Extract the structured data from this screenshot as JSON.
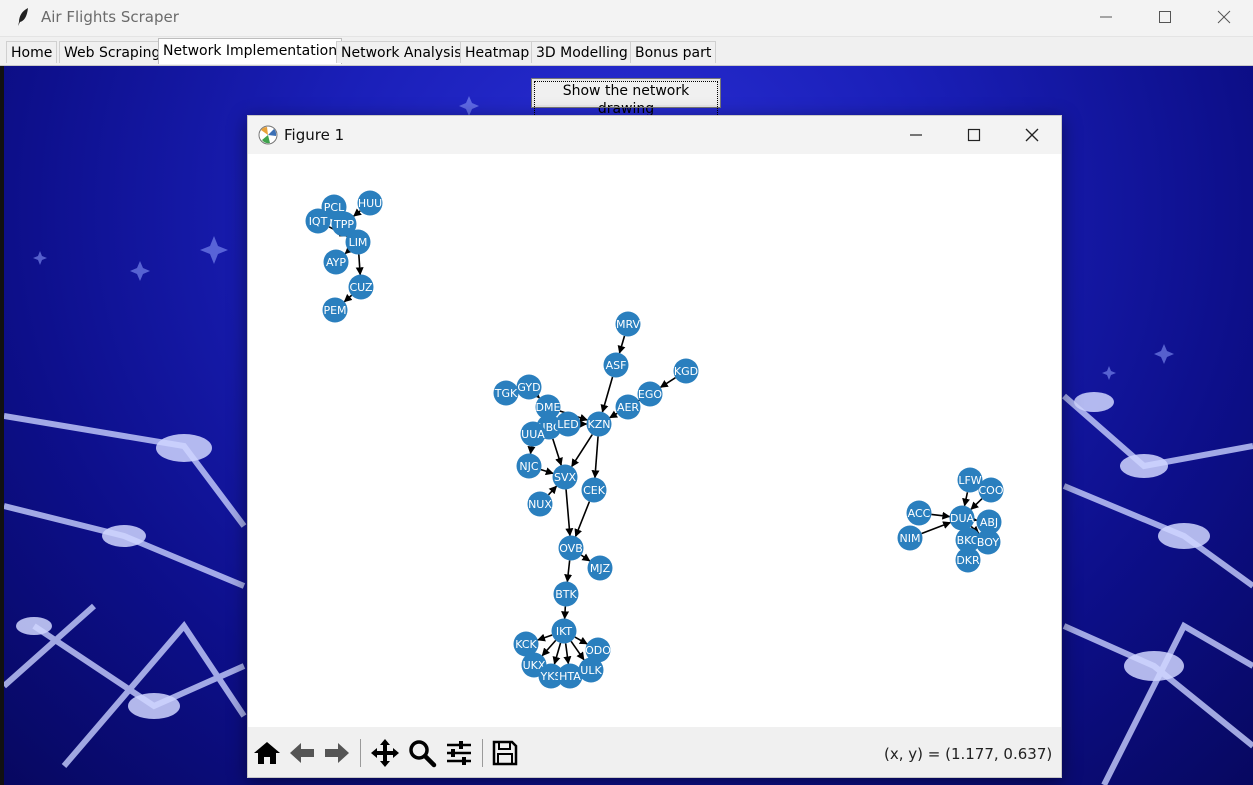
{
  "window": {
    "title": "Air Flights Scraper",
    "controls": {
      "minimize": "minimize-icon",
      "maximize": "maximize-icon",
      "close": "close-icon"
    }
  },
  "tabs": [
    {
      "label": "Home",
      "active": false
    },
    {
      "label": "Web Scraping",
      "active": false
    },
    {
      "label": "Network Implementation",
      "active": true
    },
    {
      "label": "Network Analysis",
      "active": false
    },
    {
      "label": "Heatmap",
      "active": false
    },
    {
      "label": "3D Modelling",
      "active": false
    },
    {
      "label": "Bonus part",
      "active": false
    }
  ],
  "main": {
    "show_network_button": "Show the network drawing"
  },
  "figure": {
    "title": "Figure 1",
    "coords": "(x, y) = (1.177, 0.637)",
    "toolbar": [
      "home-icon",
      "back-arrow-icon",
      "forward-arrow-icon",
      "pan-icon",
      "zoom-icon",
      "configure-subplots-icon",
      "save-icon"
    ]
  },
  "colors": {
    "node": "#2a7fbe",
    "background_dark": "#0d0f8a",
    "edge": "#000000"
  },
  "graph": {
    "nodes": [
      "PCL",
      "HUU",
      "IQT",
      "TPP",
      "LIM",
      "AYP",
      "CUZ",
      "PEM",
      "MRV",
      "ASF",
      "KGD",
      "EGO",
      "AER",
      "TGK",
      "GYD",
      "DME",
      "NBC",
      "LED",
      "KZN",
      "UUA",
      "NJC",
      "SVX",
      "CEK",
      "NUX",
      "OVB",
      "MJZ",
      "BTK",
      "IKT",
      "KCK",
      "ODO",
      "UKX",
      "YKS",
      "HTA",
      "ULK",
      "LFW",
      "COO",
      "ACC",
      "DUA",
      "ABJ",
      "NIM",
      "BKO",
      "BOY",
      "DKR"
    ],
    "edges": [
      [
        "HUU",
        "TPP"
      ],
      [
        "TPP",
        "LIM"
      ],
      [
        "PCL",
        "LIM"
      ],
      [
        "IQT",
        "LIM"
      ],
      [
        "LIM",
        "AYP"
      ],
      [
        "LIM",
        "CUZ"
      ],
      [
        "CUZ",
        "PEM"
      ],
      [
        "MRV",
        "ASF"
      ],
      [
        "ASF",
        "KZN"
      ],
      [
        "KGD",
        "EGO"
      ],
      [
        "EGO",
        "AER"
      ],
      [
        "AER",
        "KZN"
      ],
      [
        "TGK",
        "GYD"
      ],
      [
        "GYD",
        "DME"
      ],
      [
        "DME",
        "KZN"
      ],
      [
        "LED",
        "KZN"
      ],
      [
        "NBC",
        "LED"
      ],
      [
        "UUA",
        "NBC"
      ],
      [
        "UUA",
        "NJC"
      ],
      [
        "NJC",
        "SVX"
      ],
      [
        "NBC",
        "SVX"
      ],
      [
        "KZN",
        "SVX"
      ],
      [
        "KZN",
        "CEK"
      ],
      [
        "NUX",
        "SVX"
      ],
      [
        "SVX",
        "OVB"
      ],
      [
        "CEK",
        "OVB"
      ],
      [
        "OVB",
        "MJZ"
      ],
      [
        "OVB",
        "BTK"
      ],
      [
        "BTK",
        "IKT"
      ],
      [
        "IKT",
        "KCK"
      ],
      [
        "IKT",
        "ODO"
      ],
      [
        "IKT",
        "UKX"
      ],
      [
        "IKT",
        "YKS"
      ],
      [
        "IKT",
        "HTA"
      ],
      [
        "IKT",
        "ULK"
      ],
      [
        "LFW",
        "DUA"
      ],
      [
        "COO",
        "DUA"
      ],
      [
        "ACC",
        "DUA"
      ],
      [
        "NIM",
        "DUA"
      ],
      [
        "DUA",
        "ABJ"
      ],
      [
        "DUA",
        "BKO"
      ],
      [
        "DUA",
        "BOY"
      ],
      [
        "DUA",
        "DKR"
      ]
    ]
  }
}
